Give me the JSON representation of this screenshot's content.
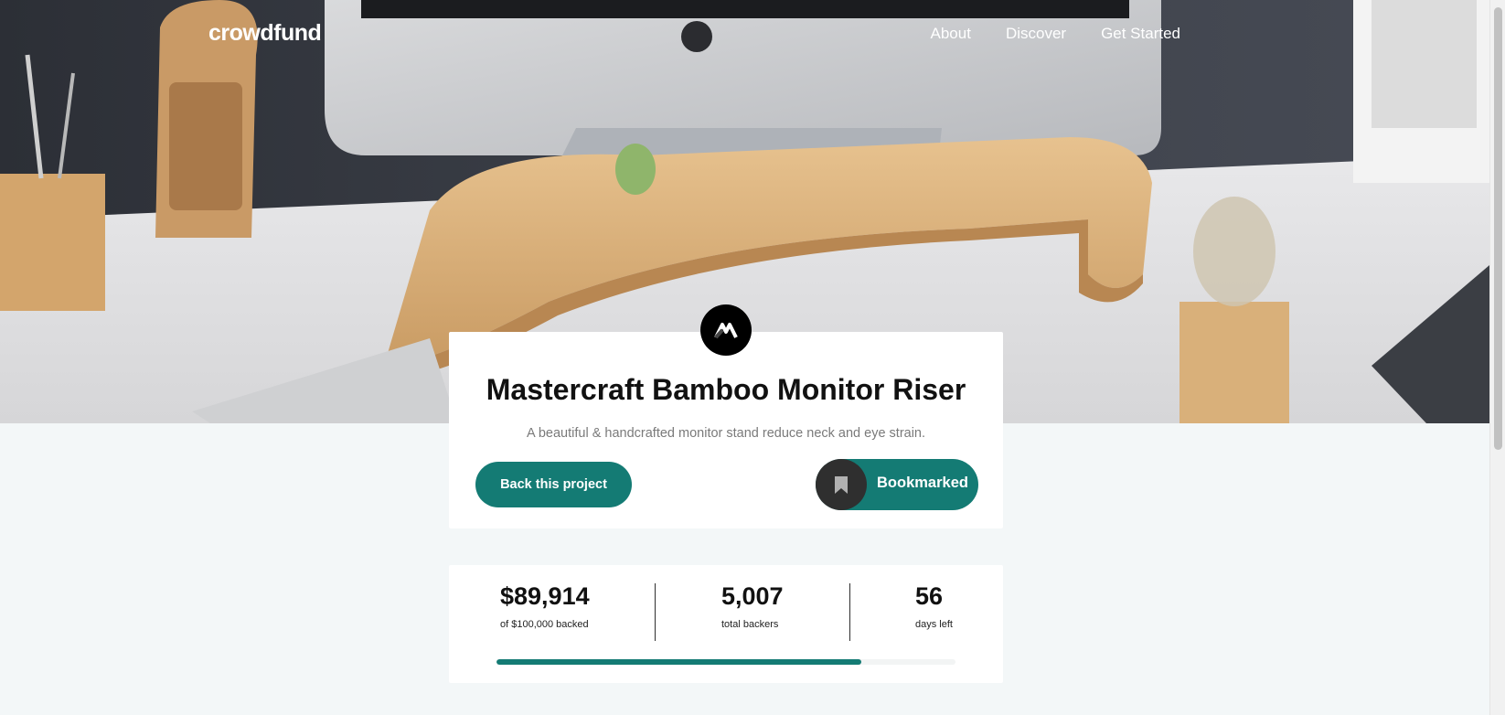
{
  "nav": {
    "logo": "crowdfund",
    "links": [
      "About",
      "Discover",
      "Get Started"
    ]
  },
  "project": {
    "logo_icon": "mastercraft-logo-icon",
    "title": "Mastercraft Bamboo Monitor Riser",
    "subtitle": "A beautiful & handcrafted monitor stand reduce neck and eye strain.",
    "back_button": "Back this project",
    "bookmark_icon": "bookmark-icon",
    "bookmark_label": "Bookmarked"
  },
  "stats": {
    "backed_amount": "$89,914",
    "backed_label": "of $100,000 backed",
    "backers": "5,007",
    "backers_label": "total backers",
    "days": "56",
    "days_label": "days left",
    "progress_fraction": 0.795
  },
  "colors": {
    "accent": "#147b74",
    "page_bg": "#f3f7f8",
    "dark": "#2f2f2f"
  }
}
